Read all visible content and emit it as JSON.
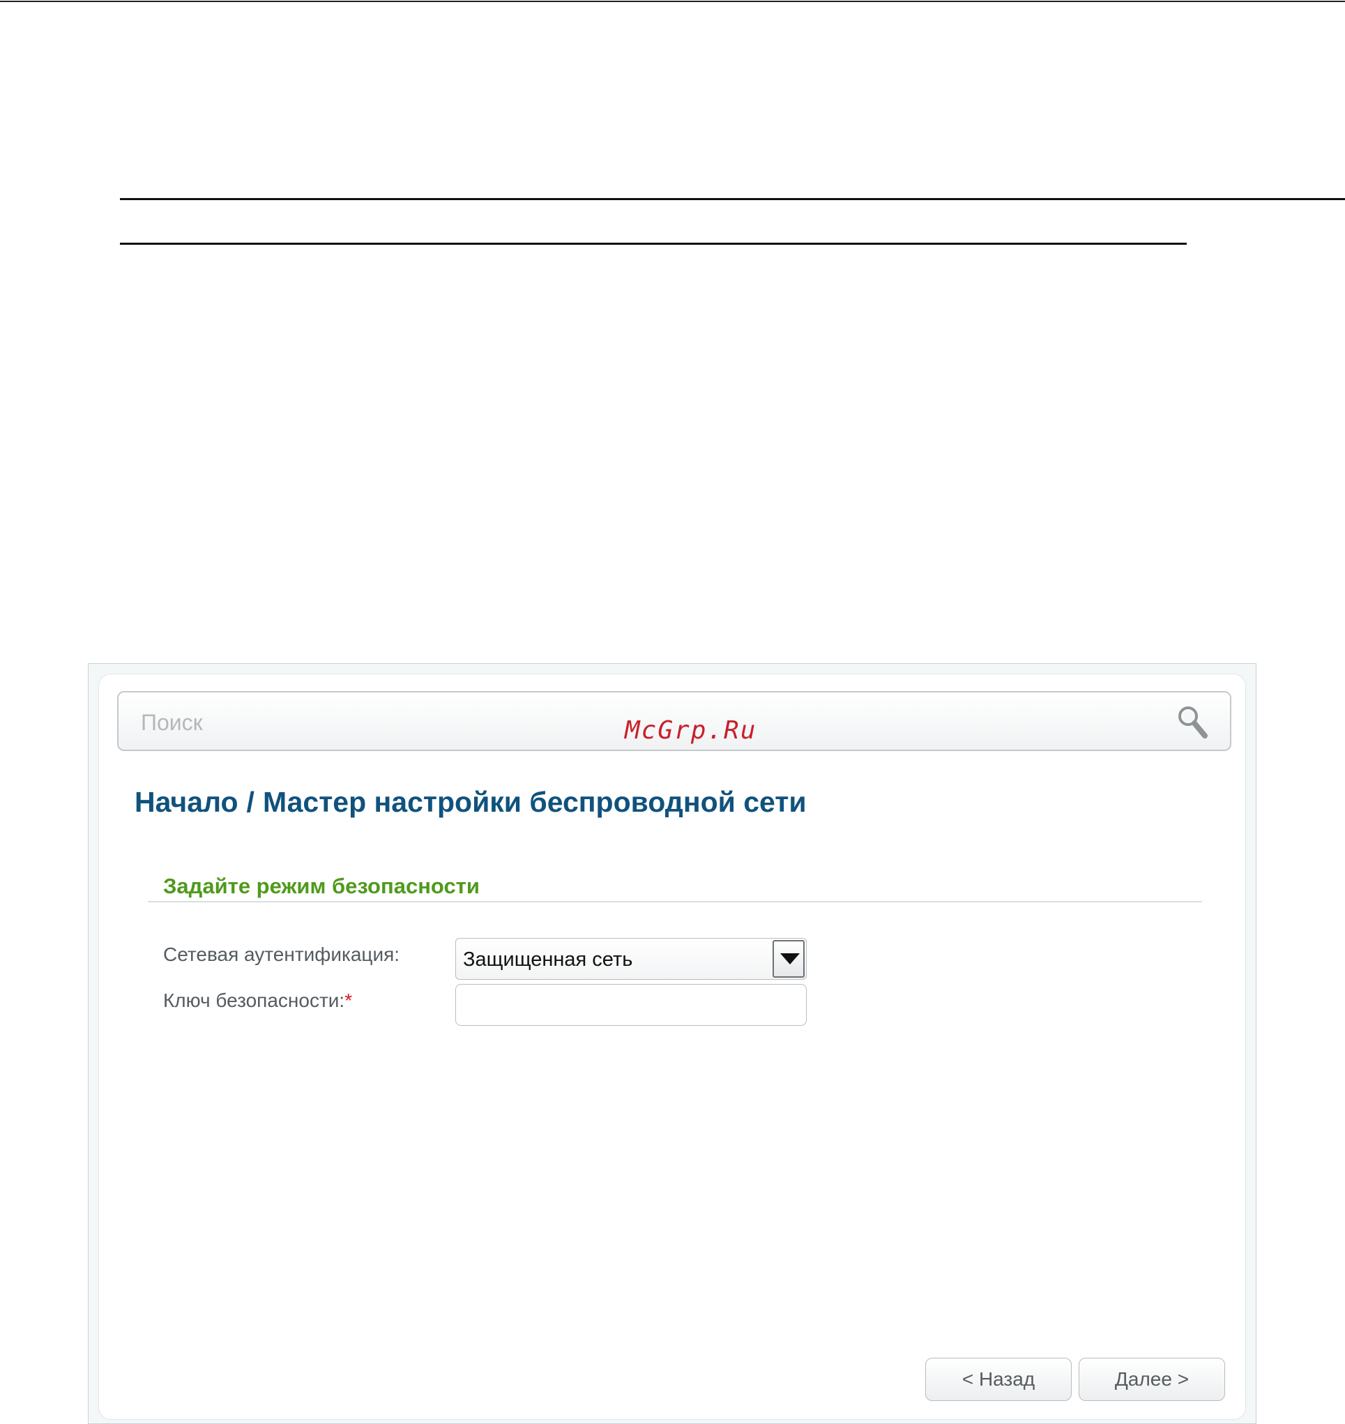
{
  "search": {
    "placeholder": "Поиск",
    "value": ""
  },
  "watermark": "McGrp.Ru",
  "breadcrumb": {
    "home": "Начало",
    "separator": "/",
    "current": "Мастер настройки беспроводной сети"
  },
  "section": {
    "title": "Задайте режим безопасности"
  },
  "form": {
    "auth_label": "Сетевая аутентификация:",
    "auth_value": "Защищенная сеть",
    "key_label": "Ключ безопасности:",
    "required_mark": "*",
    "key_value": ""
  },
  "buttons": {
    "back": "< Назад",
    "next": "Далее >"
  },
  "colors": {
    "breadcrumb": "#10527d",
    "section_title": "#4f9a1c",
    "required": "#d71920",
    "watermark": "#c8202a"
  }
}
